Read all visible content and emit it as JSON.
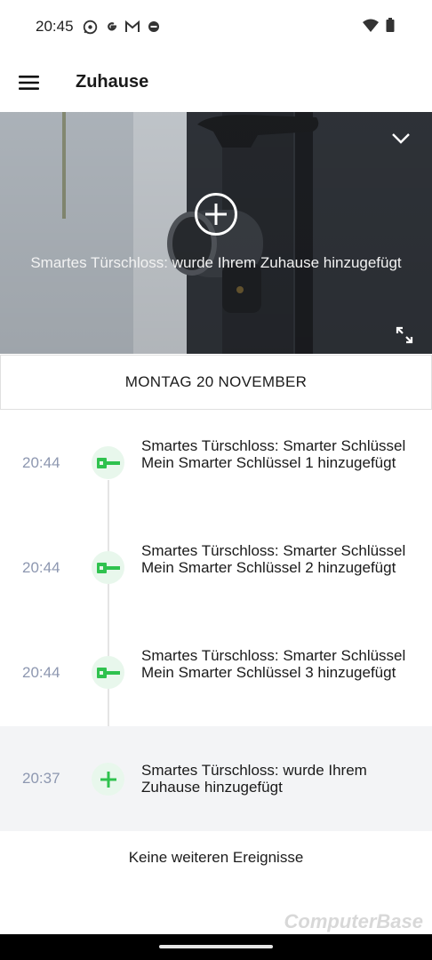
{
  "status_bar": {
    "time": "20:45",
    "left_icons": [
      "whatsapp-icon",
      "google-icon",
      "gmail-icon",
      "dnd-icon"
    ],
    "right_icons": [
      "wifi-icon",
      "battery-icon"
    ]
  },
  "app_bar": {
    "title": "Zuhause"
  },
  "hero": {
    "caption": "Smartes Türschloss: wurde Ihrem Zuhause hinzugefügt"
  },
  "date_header": "MONTAG 20 NOVEMBER",
  "events": [
    {
      "time": "20:44",
      "icon": "key-icon",
      "text": "Smartes Türschloss: Smarter Schlüssel Mein Smarter Schlüssel 1 hinzugefügt"
    },
    {
      "time": "20:44",
      "icon": "key-icon",
      "text": "Smartes Türschloss: Smarter Schlüssel Mein Smarter Schlüssel 2 hinzugefügt"
    },
    {
      "time": "20:44",
      "icon": "key-icon",
      "text": "Smartes Türschloss: Smarter Schlüssel Mein Smarter Schlüssel 3 hinzugefügt"
    },
    {
      "time": "20:37",
      "icon": "plus-icon",
      "text": "Smartes Türschloss: wurde Ihrem Zuhause hinzugefügt"
    }
  ],
  "no_more_events": "Keine weiteren Ereignisse",
  "watermark": "ComputerBase",
  "colors": {
    "accent_green": "#2fc24e",
    "icon_bg": "#e8f7ec",
    "time_text": "#8d97b0",
    "highlight_row": "#f3f4f6"
  }
}
